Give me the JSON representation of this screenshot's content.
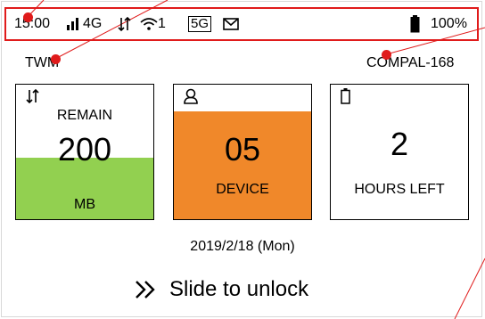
{
  "status_bar": {
    "time": "15:00",
    "signal_icon": "signal-bars-icon",
    "network_type": "4G",
    "data_icon": "data-transfer-icon",
    "wifi_icon": "wifi-icon",
    "wifi_clients": "1",
    "badge_5g": "5G",
    "mail_icon": "mail-icon",
    "battery_icon": "battery-icon",
    "battery_percent": "100%"
  },
  "carrier": "TWM",
  "ssid": "COMPAL-168",
  "tiles": [
    {
      "icon": "data-transfer-icon",
      "top_label": "REMAIN",
      "value": "200",
      "bottom_label": "MB",
      "fill_color": "#92d050"
    },
    {
      "icon": "user-icon",
      "value": "05",
      "bottom_label": "DEVICE",
      "fill_color": "#f0882a"
    },
    {
      "icon": "battery-outline-icon",
      "value": "2",
      "bottom_label": "HOURS LEFT"
    }
  ],
  "date": "2019/2/18 (Mon)",
  "slide_to_unlock": "Slide to unlock",
  "colors": {
    "annotation": "#e01b1b"
  }
}
